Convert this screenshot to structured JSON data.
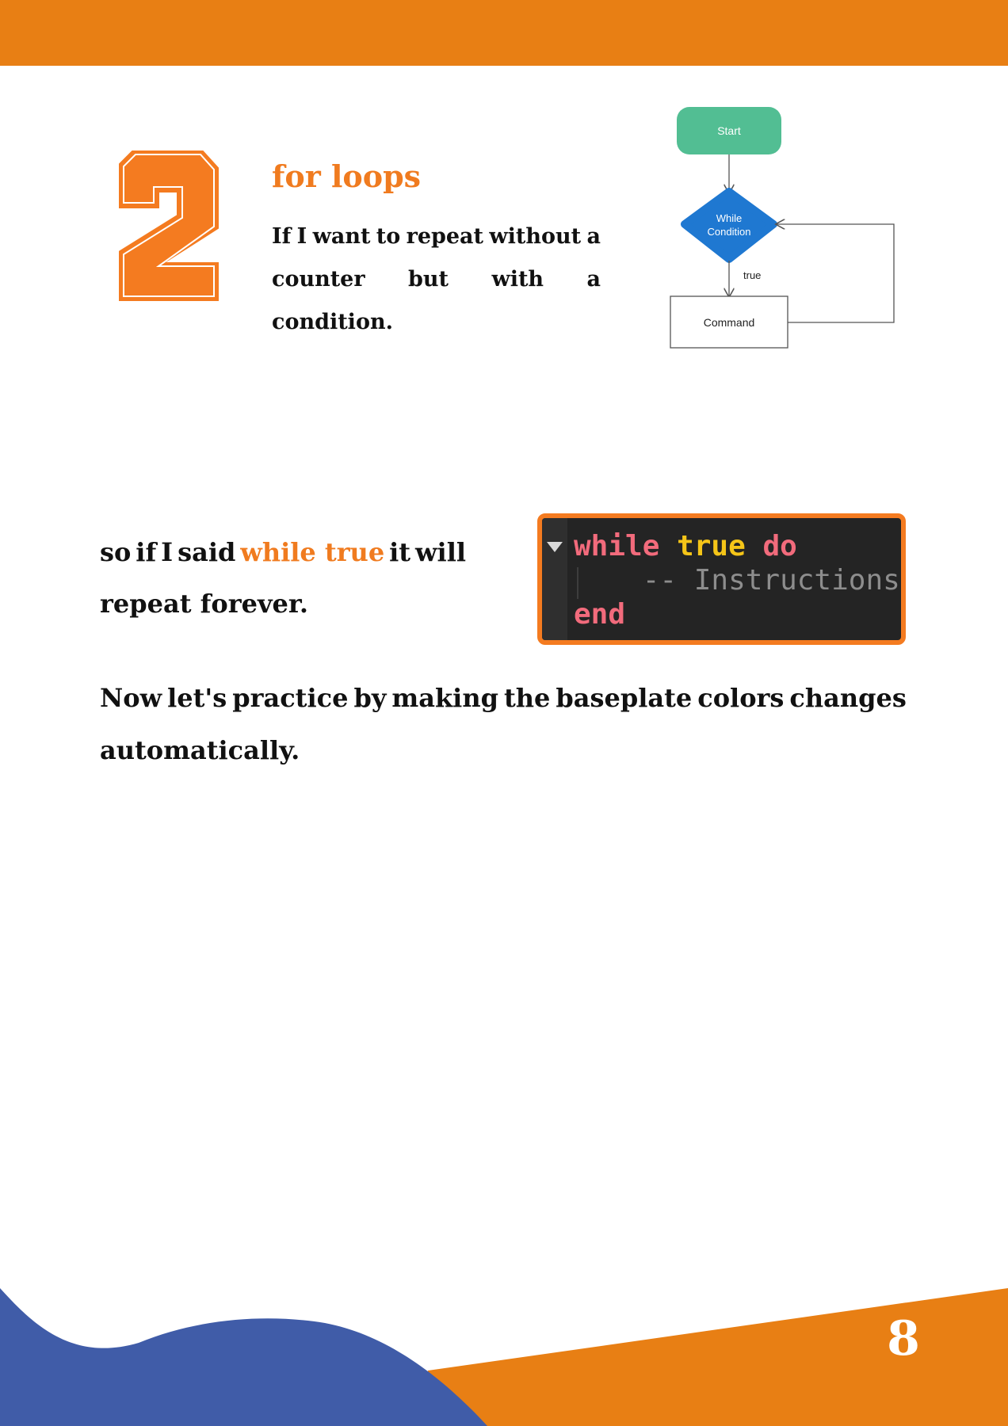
{
  "section": {
    "number": "2",
    "heading": "for loops",
    "intro_line1_words": [
      "If",
      "I",
      "want",
      "to",
      "repeat",
      "without",
      "a"
    ],
    "intro_line2": "counter but with a condition."
  },
  "flowchart": {
    "start": "Start",
    "condition_line1": "While",
    "condition_line2": "Condition",
    "edge_label": "true",
    "command": "Command"
  },
  "while_text": {
    "line1_words": [
      "so",
      "if",
      "I",
      "said"
    ],
    "highlight": "while true",
    "line1_tail_words": [
      "it",
      "will"
    ],
    "line2": "repeat forever."
  },
  "code": {
    "kw_while": "while",
    "kw_true": "true",
    "kw_do": "do",
    "comment": "    -- Instructions",
    "kw_end": "end"
  },
  "practice": {
    "line1_words": [
      "Now",
      "let's",
      "practice",
      "by",
      "making",
      "the",
      "baseplate",
      "colors",
      "changes"
    ],
    "line2": "automatically."
  },
  "page_number": "8",
  "colors": {
    "orange": "#e87f14",
    "blue": "#405ca8",
    "highlight": "#f07b1f",
    "start_node": "#52be93",
    "condition_node": "#1f78d1"
  }
}
